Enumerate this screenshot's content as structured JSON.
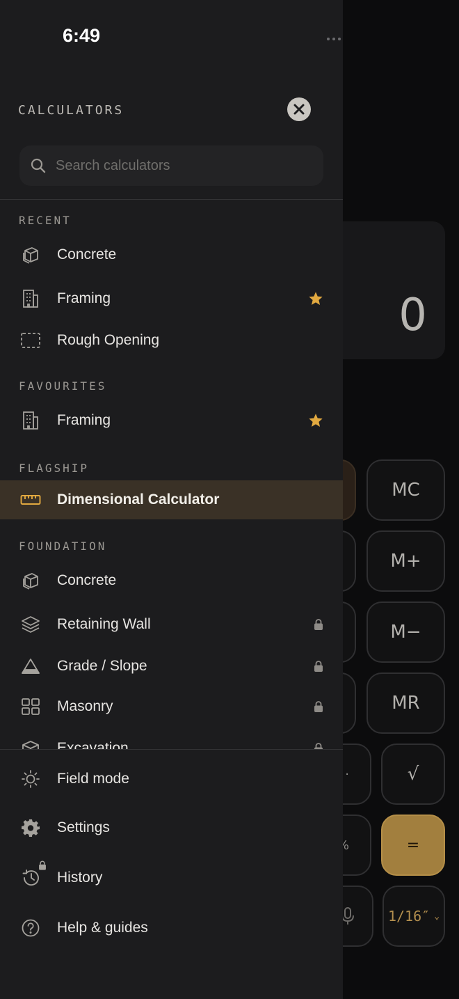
{
  "status": {
    "time": "6:49"
  },
  "calculator": {
    "display_value": "0",
    "keys": {
      "mc": "MC",
      "m_plus": "M+",
      "m_minus": "M−",
      "mr": "MR",
      "sqrt": "√",
      "equals": "=",
      "fraction": "1/16″",
      "partial_dot": "·",
      "partial_percent": "%"
    }
  },
  "drawer": {
    "title": "CALCULATORS",
    "search": {
      "placeholder": "Search calculators",
      "value": ""
    },
    "sections": {
      "recent": {
        "label": "RECENT",
        "items": [
          {
            "label": "Concrete",
            "icon": "cube-stack-icon"
          },
          {
            "label": "Framing",
            "icon": "building-icon",
            "favourite": true
          },
          {
            "label": "Rough Opening",
            "icon": "dashed-rectangle-icon"
          }
        ]
      },
      "favourites": {
        "label": "FAVOURITES",
        "items": [
          {
            "label": "Framing",
            "icon": "building-icon",
            "favourite": true
          }
        ]
      },
      "flagship": {
        "label": "FLAGSHIP",
        "items": [
          {
            "label": "Dimensional Calculator",
            "icon": "ruler-icon",
            "active": true
          }
        ]
      },
      "foundation": {
        "label": "FOUNDATION",
        "items": [
          {
            "label": "Concrete",
            "icon": "cube-stack-icon"
          },
          {
            "label": "Retaining Wall",
            "icon": "layers-icon",
            "locked": true
          },
          {
            "label": "Grade / Slope",
            "icon": "triangle-icon",
            "locked": true
          },
          {
            "label": "Masonry",
            "icon": "grid-icon",
            "locked": true
          },
          {
            "label": "Excavation",
            "icon": "box-icon",
            "locked": true
          }
        ]
      }
    },
    "footer": [
      {
        "label": "Field mode",
        "icon": "sun-icon"
      },
      {
        "label": "Settings",
        "icon": "gear-icon"
      },
      {
        "label": "History",
        "icon": "history-icon",
        "locked": true
      },
      {
        "label": "Help & guides",
        "icon": "help-circle-icon"
      }
    ],
    "colors": {
      "accent": "#e2a940",
      "active_bg": "#3a3126",
      "panel": "#1c1c1e"
    }
  }
}
